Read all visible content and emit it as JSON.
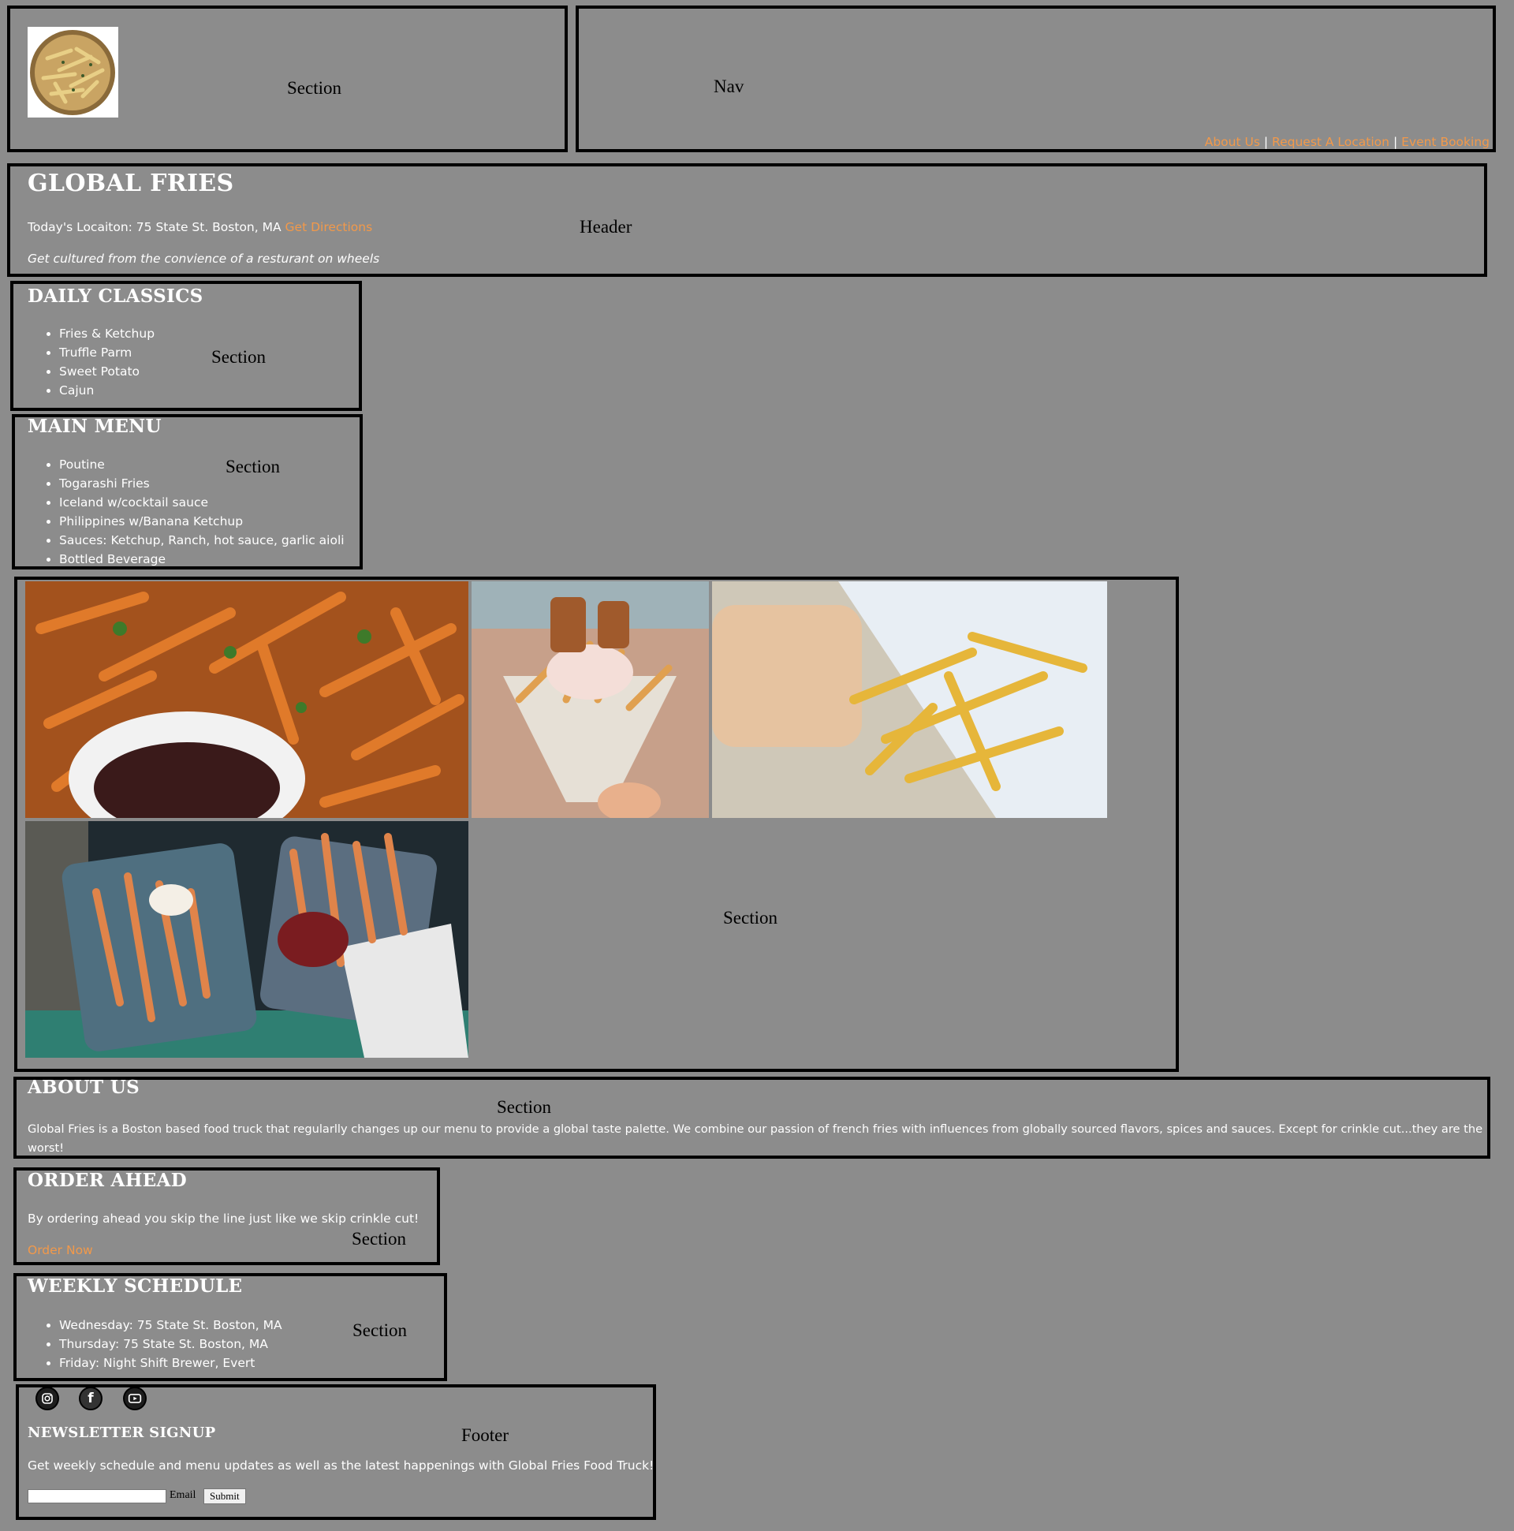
{
  "top_section": {
    "label": "Section",
    "logo": "fries-logo"
  },
  "nav": {
    "label": "Nav",
    "links": [
      "About Us",
      "Request A Location",
      "Event Booking"
    ],
    "separator": "|"
  },
  "header": {
    "label": "Header",
    "title": "GLOBAL FRIES",
    "location_text": "Today's Locaiton: 75 State St. Boston, MA",
    "directions_link": "Get Directions",
    "tagline": "Get cultured from the convience of a resturant on wheels"
  },
  "daily_classics": {
    "label": "Section",
    "title": "DAILY CLASSICS",
    "items": [
      "Fries & Ketchup",
      "Truffle Parm",
      "Sweet Potato",
      "Cajun"
    ]
  },
  "main_menu": {
    "label": "Section",
    "title": "MAIN MENU",
    "items": [
      "Poutine",
      "Togarashi Fries",
      "Iceland w/cocktail sauce",
      "Philippines w/Banana Ketchup",
      "Sauces: Ketchup, Ranch, hot sauce, garlic aioli",
      "Bottled Beverage"
    ]
  },
  "gallery": {
    "label": "Section",
    "photos": [
      "sweet-potato-fries-photo",
      "fries-cone-photo",
      "fries-bag-photo",
      "fries-trays-photo"
    ]
  },
  "about": {
    "label": "Section",
    "title": "ABOUT US",
    "text_line1": "Global Fries is a Boston based food truck that regularlly changes up our menu to provide a global taste palette. We combine our passion of french fries with influences from globally sourced flavors, spices and sauces. Except for crinkle cut...they are the",
    "text_line2": "worst!"
  },
  "order": {
    "label": "Section",
    "title": "ORDER AHEAD",
    "text": "By ordering ahead you skip the line just like we skip crinkle cut!",
    "link": "Order Now"
  },
  "schedule": {
    "label": "Section",
    "title": "WEEKLY SCHEDULE",
    "items": [
      "Wednesday: 75 State St. Boston, MA",
      "Thursday: 75 State St. Boston, MA",
      "Friday: Night Shift Brewer, Evert"
    ]
  },
  "footer": {
    "label": "Footer",
    "social_icons": [
      "instagram-icon",
      "facebook-icon",
      "youtube-icon"
    ],
    "newsletter_title": "NEWSLETTER SIGNUP",
    "newsletter_text": "Get weekly schedule and menu updates as well as the latest happenings with Global Fries Food Truck!",
    "email_label": "Email",
    "email_value": "",
    "submit_label": "Submit"
  },
  "colors": {
    "background": "#8c8c8c",
    "border": "#000000",
    "link": "#f2994a",
    "text": "#ffffff"
  }
}
